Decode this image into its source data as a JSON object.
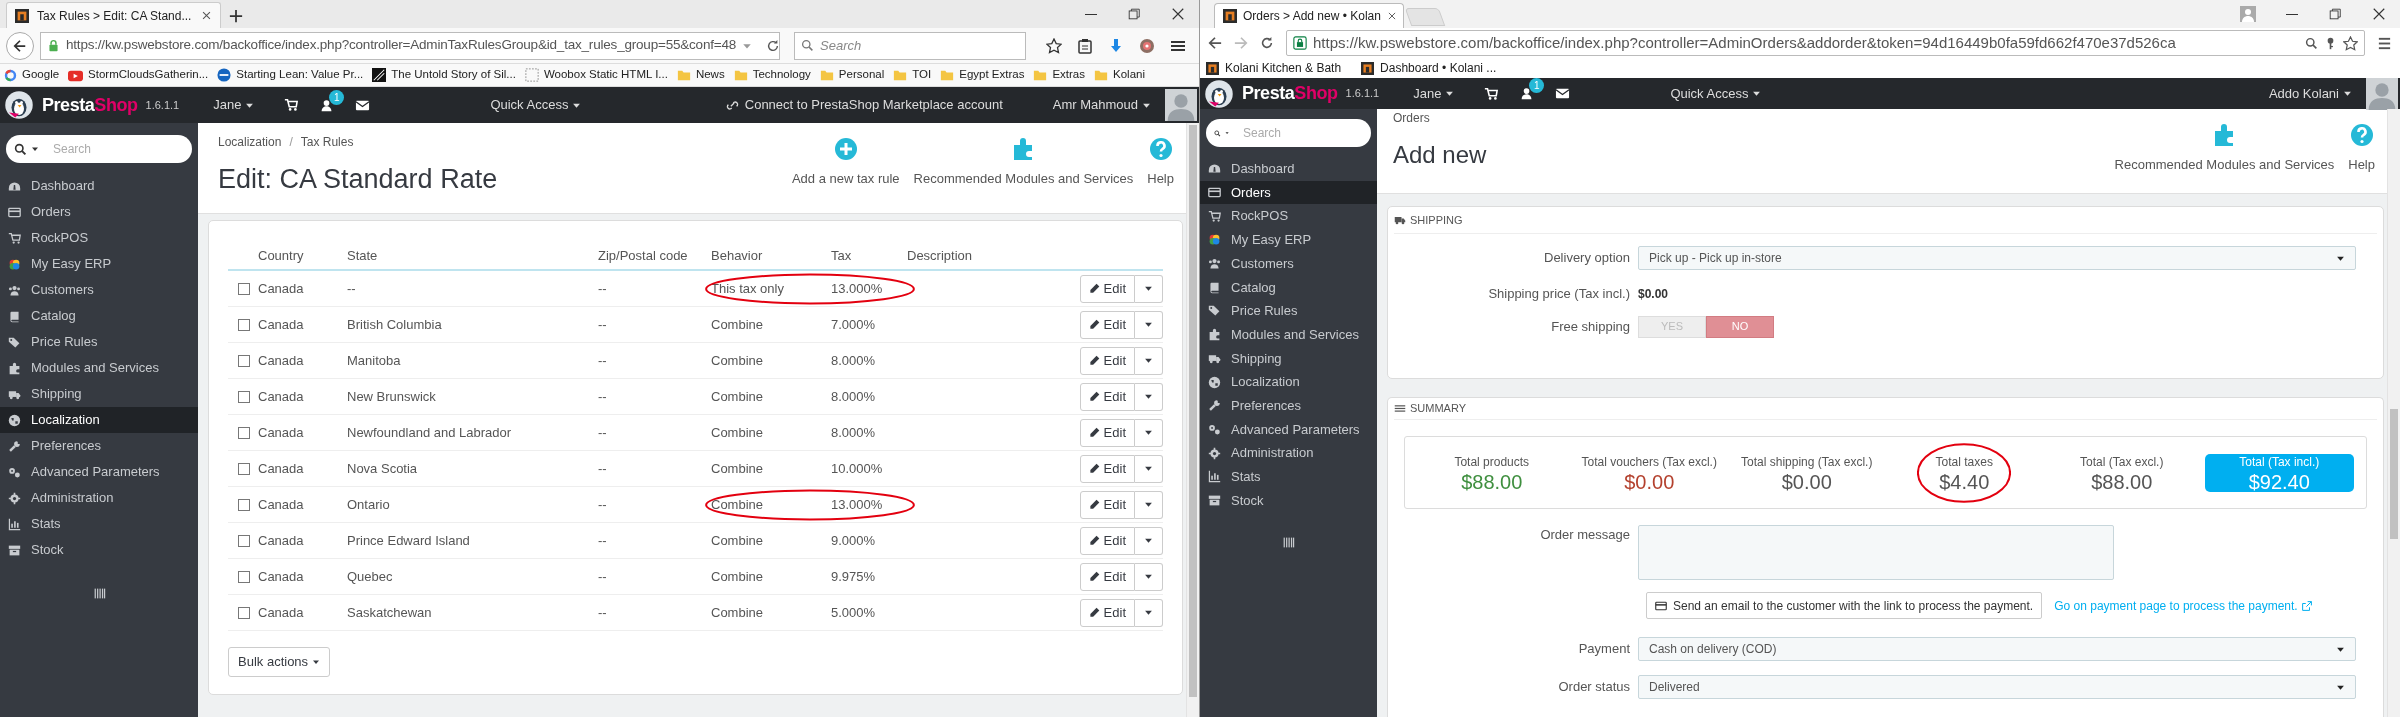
{
  "left_window": {
    "tab_title": "Tax Rules > Edit: CA Stand...",
    "url": "https://kw.pswebstore.com/backoffice/index.php?controller=AdminTaxRulesGroup&id_tax_rules_group=55&conf=48",
    "search_placeholder": "Search",
    "bookmarks": [
      {
        "label": "Google",
        "kind": "ring"
      },
      {
        "label": "StormCloudsGatherin...",
        "kind": "video"
      },
      {
        "label": "Starting Lean: Value Pr...",
        "kind": "site"
      },
      {
        "label": "The Untold Story of Sil...",
        "kind": "dark"
      },
      {
        "label": "Woobox Static HTML I...",
        "kind": "page"
      },
      {
        "label": "News",
        "kind": "folder"
      },
      {
        "label": "Technology",
        "kind": "folder"
      },
      {
        "label": "Personal",
        "kind": "folder"
      },
      {
        "label": "TOI",
        "kind": "folder"
      },
      {
        "label": "Egypt Extras",
        "kind": "folder"
      },
      {
        "label": "Extras",
        "kind": "folder"
      },
      {
        "label": "Kolani",
        "kind": "folder"
      }
    ],
    "header": {
      "brand": [
        {
          "text": "Presta",
          "accent": false
        },
        {
          "text": "Shop",
          "accent": true
        }
      ],
      "version": "1.6.1.1",
      "employee": "Jane",
      "notification_count": "1",
      "quick_access": "Quick Access",
      "marketplace": "Connect to PrestaShop Marketplace account",
      "account": "Amr Mahmoud"
    },
    "sidebar": {
      "search_placeholder": "Search",
      "items": [
        {
          "label": "Dashboard",
          "selected": false
        },
        {
          "label": "Orders",
          "selected": false
        },
        {
          "label": "RockPOS",
          "selected": false
        },
        {
          "label": "My Easy ERP",
          "selected": false
        },
        {
          "label": "Customers",
          "selected": false
        },
        {
          "label": "Catalog",
          "selected": false
        },
        {
          "label": "Price Rules",
          "selected": false
        },
        {
          "label": "Modules and Services",
          "selected": false
        },
        {
          "label": "Shipping",
          "selected": false
        },
        {
          "label": "Localization",
          "selected": true
        },
        {
          "label": "Preferences",
          "selected": false
        },
        {
          "label": "Advanced Parameters",
          "selected": false
        },
        {
          "label": "Administration",
          "selected": false
        },
        {
          "label": "Stats",
          "selected": false
        },
        {
          "label": "Stock",
          "selected": false
        }
      ]
    },
    "breadcrumb": [
      "Localization",
      "Tax Rules"
    ],
    "breadcrumb_separator": "/",
    "title": "Edit: CA Standard Rate",
    "toolbar": [
      {
        "label": "Add a new tax rule",
        "kind": "add"
      },
      {
        "label": "Recommended Modules and Services",
        "kind": "modules"
      },
      {
        "label": "Help",
        "kind": "help"
      }
    ],
    "table": {
      "columns": [
        "Country",
        "State",
        "Zip/Postal code",
        "Behavior",
        "Tax",
        "Description"
      ],
      "rows": [
        {
          "cells": [
            "Canada",
            "--",
            "--",
            "This tax only",
            "13.000%"
          ],
          "checked": false,
          "circled": true,
          "action": "Edit"
        },
        {
          "cells": [
            "Canada",
            "British Columbia",
            "--",
            "Combine",
            "7.000%"
          ],
          "checked": false,
          "circled": false,
          "action": "Edit"
        },
        {
          "cells": [
            "Canada",
            "Manitoba",
            "--",
            "Combine",
            "8.000%"
          ],
          "checked": false,
          "circled": false,
          "action": "Edit"
        },
        {
          "cells": [
            "Canada",
            "New Brunswick",
            "--",
            "Combine",
            "8.000%"
          ],
          "checked": false,
          "circled": false,
          "action": "Edit"
        },
        {
          "cells": [
            "Canada",
            "Newfoundland and Labrador",
            "--",
            "Combine",
            "8.000%"
          ],
          "checked": false,
          "circled": false,
          "action": "Edit"
        },
        {
          "cells": [
            "Canada",
            "Nova Scotia",
            "--",
            "Combine",
            "10.000%"
          ],
          "checked": false,
          "circled": false,
          "action": "Edit"
        },
        {
          "cells": [
            "Canada",
            "Ontario",
            "--",
            "Combine",
            "13.000%"
          ],
          "checked": false,
          "circled": true,
          "action": "Edit"
        },
        {
          "cells": [
            "Canada",
            "Prince Edward Island",
            "--",
            "Combine",
            "9.000%"
          ],
          "checked": false,
          "circled": false,
          "action": "Edit"
        },
        {
          "cells": [
            "Canada",
            "Quebec",
            "--",
            "Combine",
            "9.975%"
          ],
          "checked": false,
          "circled": false,
          "action": "Edit"
        },
        {
          "cells": [
            "Canada",
            "Saskatchewan",
            "--",
            "Combine",
            "5.000%"
          ],
          "checked": false,
          "circled": false,
          "action": "Edit"
        }
      ]
    },
    "bulk_actions": "Bulk actions"
  },
  "right_window": {
    "tab_title": "Orders > Add new • Kolan",
    "url": "https://kw.pswebstore.com/backoffice/index.php?controller=AdminOrders&addorder&token=94d16449b0fa59fd662f470e37d526ca",
    "bookmarks": [
      {
        "label": "Kolani Kitchen & Bath"
      },
      {
        "label": "Dashboard • Kolani ..."
      }
    ],
    "header": {
      "brand": [
        {
          "text": "Presta",
          "accent": false
        },
        {
          "text": "Shop",
          "accent": true
        }
      ],
      "version": "1.6.1.1",
      "employee": "Jane",
      "notification_count": "1",
      "quick_access": "Quick Access",
      "account": "Addo Kolani"
    },
    "sidebar": {
      "search_placeholder": "Search",
      "items": [
        {
          "label": "Dashboard",
          "selected": false
        },
        {
          "label": "Orders",
          "selected": true
        },
        {
          "label": "RockPOS",
          "selected": false
        },
        {
          "label": "My Easy ERP",
          "selected": false
        },
        {
          "label": "Customers",
          "selected": false
        },
        {
          "label": "Catalog",
          "selected": false
        },
        {
          "label": "Price Rules",
          "selected": false
        },
        {
          "label": "Modules and Services",
          "selected": false
        },
        {
          "label": "Shipping",
          "selected": false
        },
        {
          "label": "Localization",
          "selected": false
        },
        {
          "label": "Preferences",
          "selected": false
        },
        {
          "label": "Advanced Parameters",
          "selected": false
        },
        {
          "label": "Administration",
          "selected": false
        },
        {
          "label": "Stats",
          "selected": false
        },
        {
          "label": "Stock",
          "selected": false
        }
      ]
    },
    "breadcrumb": [
      "Orders"
    ],
    "title": "Add new",
    "toolbar": [
      {
        "label": "Recommended Modules and Services",
        "kind": "modules"
      },
      {
        "label": "Help",
        "kind": "help"
      }
    ],
    "shipping": {
      "heading": "SHIPPING",
      "delivery_label": "Delivery option",
      "delivery_value": "Pick up - Pick up in-store",
      "price_label": "Shipping price (Tax incl.)",
      "price_value": "$0.00",
      "free_label": "Free shipping",
      "free_options": [
        {
          "label": "YES",
          "selected": false
        },
        {
          "label": "NO",
          "selected": true
        }
      ]
    },
    "summary": {
      "heading": "SUMMARY",
      "totals": [
        {
          "label": "Total products",
          "value": "$88.00",
          "kind": "positive",
          "circled": false
        },
        {
          "label": "Total vouchers (Tax excl.)",
          "value": "$0.00",
          "kind": "negative",
          "circled": false
        },
        {
          "label": "Total shipping (Tax excl.)",
          "value": "$0.00",
          "kind": "neutral",
          "circled": false
        },
        {
          "label": "Total taxes",
          "value": "$4.40",
          "kind": "neutral",
          "circled": true
        },
        {
          "label": "Total (Tax excl.)",
          "value": "$88.00",
          "kind": "neutral",
          "circled": false
        },
        {
          "label": "Total (Tax incl.)",
          "value": "$92.40",
          "kind": "grand",
          "circled": false
        }
      ],
      "message_label": "Order message",
      "email_button": "Send an email to the customer with the link to process the payment.",
      "payment_link": "Go on payment page to process the payment.",
      "payment_label": "Payment",
      "payment_value": "Cash on delivery (COD)",
      "status_label": "Order status",
      "status_value": "Delivered"
    }
  }
}
